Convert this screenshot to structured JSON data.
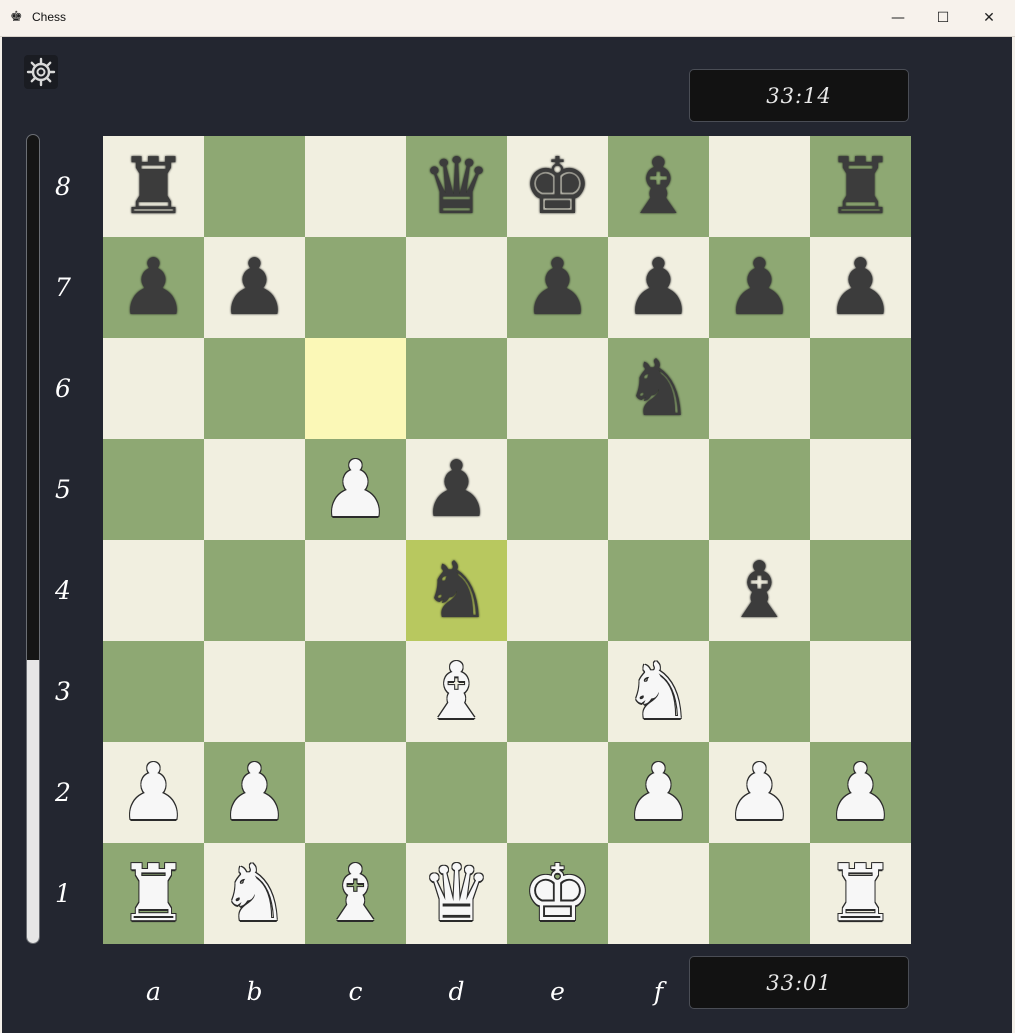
{
  "window": {
    "title": "Chess",
    "app_icon": "♚",
    "min_glyph": "—",
    "max_glyph": "☐",
    "close_glyph": "✕"
  },
  "clocks": {
    "top": "33:14",
    "bottom": "33:01"
  },
  "eval_bar": {
    "white_fraction": 0.35
  },
  "ranks": [
    "8",
    "7",
    "6",
    "5",
    "4",
    "3",
    "2",
    "1"
  ],
  "files": [
    "a",
    "b",
    "c",
    "d",
    "e",
    "f"
  ],
  "highlights": [
    "c6",
    "d4"
  ],
  "board": [
    [
      "bR",
      "",
      "",
      "bQ",
      "bK",
      "bB",
      "",
      "bR"
    ],
    [
      "bP",
      "bP",
      "",
      "",
      "bP",
      "bP",
      "bP",
      "bP"
    ],
    [
      "",
      "",
      "",
      "",
      "",
      "bN",
      "",
      ""
    ],
    [
      "",
      "",
      "wP",
      "bP",
      "",
      "",
      "",
      ""
    ],
    [
      "",
      "",
      "",
      "bN",
      "",
      "",
      "bB",
      ""
    ],
    [
      "",
      "",
      "",
      "wB",
      "",
      "wN",
      "",
      ""
    ],
    [
      "wP",
      "wP",
      "",
      "",
      "",
      "wP",
      "wP",
      "wP"
    ],
    [
      "wR",
      "wN",
      "wB",
      "wQ",
      "wK",
      "",
      "",
      "wR"
    ]
  ],
  "glyphs": {
    "K": "♚",
    "Q": "♛",
    "R": "♜",
    "B": "♝",
    "N": "♞",
    "P": "♟"
  },
  "colors": {
    "light_square": "#f1efe0",
    "dark_square": "#8ea873",
    "highlight": "#fbf8b7",
    "panel": "#232630"
  }
}
